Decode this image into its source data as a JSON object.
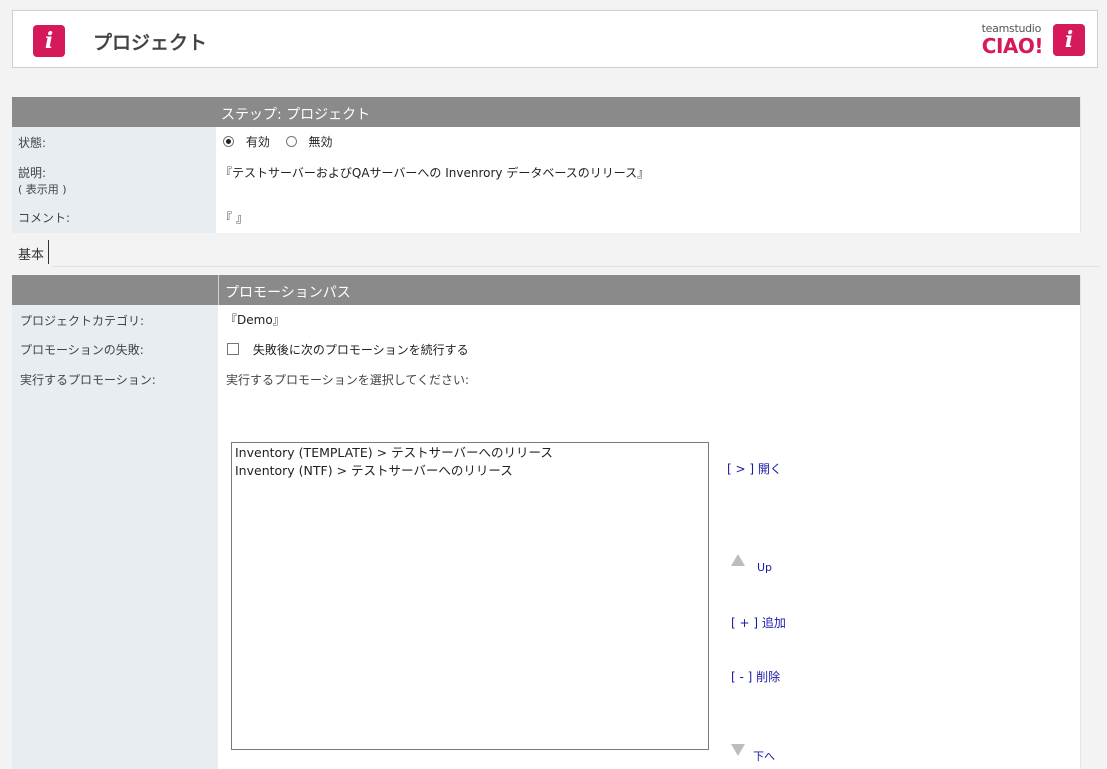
{
  "header": {
    "title": "プロジェクト",
    "brand_sub": "teamstudio",
    "brand_main": "CIAO!",
    "logo_glyph": "i",
    "accent_color": "#d6195b"
  },
  "step": {
    "header": "ステップ: プロジェクト",
    "status_label": "状態:",
    "status_options": {
      "enabled": "有効",
      "disabled": "無効"
    },
    "status_selected": "有効",
    "description_label": "説明:",
    "description_sub": "( 表示用 )",
    "description_value": "『テストサーバーおよびQAサーバーへの Invenrory データベースのリリース』",
    "comment_label": "コメント:",
    "comment_value": "『 』"
  },
  "tabs": {
    "basic": "基本"
  },
  "promotion": {
    "header": "プロモーションパス",
    "category_label": "プロジェクトカテゴリ:",
    "category_value": "『Demo』",
    "failure_label": "プロモーションの失敗:",
    "failure_checkbox_label": "失敗後に次のプロモーションを続行する",
    "failure_checked": false,
    "execute_label": "実行するプロモーション:",
    "execute_prompt": "実行するプロモーションを選択してください:",
    "list_items": [
      "Inventory (TEMPLATE) > テストサーバーへのリリース",
      "Inventory (NTF) > テストサーバーへのリリース"
    ],
    "actions": {
      "open": "[ > ] 開く",
      "up": "Up",
      "add": "[ + ] 追加",
      "delete": "[ - ] 削除",
      "down": "下へ"
    }
  }
}
